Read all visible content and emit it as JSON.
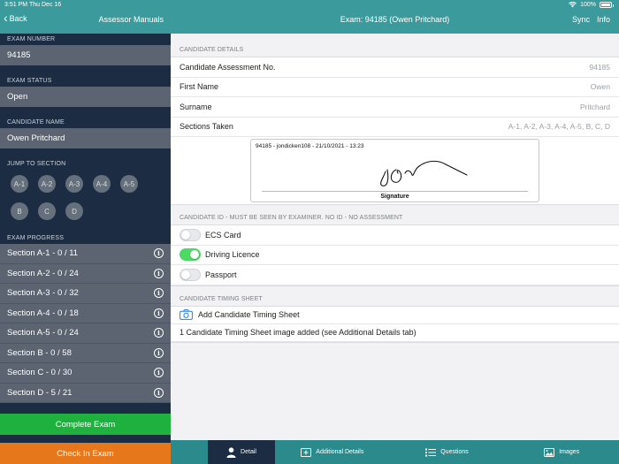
{
  "status_bar": {
    "time": "3:51 PM",
    "date": "Thu Dec 16",
    "battery": "100%"
  },
  "sidebar": {
    "back_label": "Back",
    "title": "Assessor Manuals",
    "exam_number_label": "EXAM NUMBER",
    "exam_number": "94185",
    "exam_status_label": "EXAM STATUS",
    "exam_status": "Open",
    "candidate_name_label": "CANDIDATE NAME",
    "candidate_name": "Owen Pritchard",
    "jump_label": "JUMP TO SECTION",
    "jump_row1": [
      "A-1",
      "A-2",
      "A-3",
      "A-4",
      "A-5"
    ],
    "jump_row2": [
      "B",
      "C",
      "D"
    ],
    "progress_label": "EXAM PROGRESS",
    "progress": [
      "Section A-1 - 0 / 11",
      "Section A-2 - 0 / 24",
      "Section A-3 - 0 / 32",
      "Section A-4 - 0 / 18",
      "Section A-5 - 0 / 24",
      "Section B - 0 / 58",
      "Section C - 0 / 30",
      "Section D - 5 / 21"
    ],
    "complete_label": "Complete Exam",
    "checkin_label": "Check In Exam"
  },
  "main": {
    "title": "Exam: 94185 (Owen Pritchard)",
    "sync_label": "Sync",
    "info_label": "Info",
    "candidate_details_header": "CANDIDATE DETAILS",
    "details": [
      {
        "label": "Candidate Assessment No.",
        "value": "94185"
      },
      {
        "label": "First Name",
        "value": "Owen"
      },
      {
        "label": "Surname",
        "value": "Pritchard"
      },
      {
        "label": "Sections Taken",
        "value": "A-1, A-2, A-3, A-4, A-5, B, C, D"
      }
    ],
    "signature_caption": "94185 - jondicken108 - 21/10/2021 - 13:23",
    "signature_label": "Signature",
    "candidate_id_header": "CANDIDATE ID - MUST BE SEEN BY EXAMINER. NO ID - NO ASSESSMENT",
    "id_options": [
      {
        "label": "ECS Card",
        "on": false
      },
      {
        "label": "Driving Licence",
        "on": true
      },
      {
        "label": "Passport",
        "on": false
      }
    ],
    "timing_header": "CANDIDATE TIMING SHEET",
    "add_timing_label": "Add Candidate Timing Sheet",
    "timing_note": "1 Candidate Timing Sheet image added (see Additional Details tab)"
  },
  "tabs": [
    {
      "label": "Detail",
      "icon": "person-icon"
    },
    {
      "label": "Additional Details",
      "icon": "add-details-icon"
    },
    {
      "label": "Questions",
      "icon": "list-icon"
    },
    {
      "label": "Images",
      "icon": "image-icon"
    }
  ],
  "colors": {
    "nav": "#3b9b9c",
    "sidebar": "#1c2c42",
    "complete": "#1eb13e",
    "checkin": "#e6771b",
    "toggle_on": "#4cd964"
  }
}
